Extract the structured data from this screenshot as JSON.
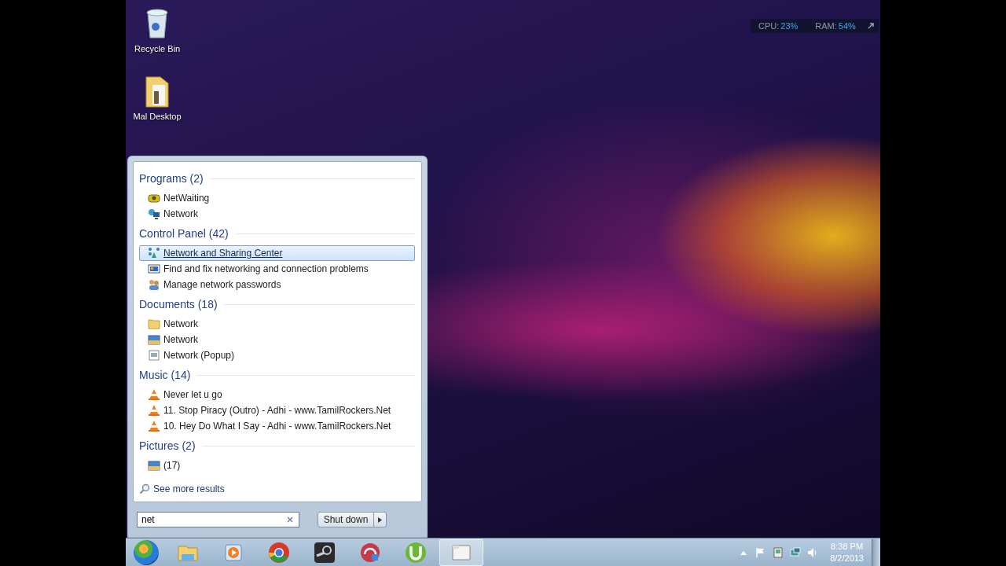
{
  "desktop_icons": [
    {
      "label": "Recycle Bin",
      "kind": "recycle"
    },
    {
      "label": "Mal Desktop",
      "kind": "folder"
    }
  ],
  "gadget": {
    "cpu_label": "CPU:",
    "cpu_value": "23%",
    "ram_label": "RAM:",
    "ram_value": "54%"
  },
  "start_menu": {
    "groups": [
      {
        "title": "Programs (2)",
        "items": [
          {
            "label": "NetWaiting",
            "kind": "phone",
            "selected": false
          },
          {
            "label": "Network",
            "kind": "network",
            "selected": false
          }
        ]
      },
      {
        "title": "Control Panel (42)",
        "items": [
          {
            "label": "Network and Sharing Center",
            "kind": "sharing",
            "selected": true
          },
          {
            "label": "Find and fix networking and connection problems",
            "kind": "troubleshoot",
            "selected": false
          },
          {
            "label": "Manage network passwords",
            "kind": "users",
            "selected": false
          }
        ]
      },
      {
        "title": "Documents (18)",
        "items": [
          {
            "label": "Network",
            "kind": "folder",
            "selected": false
          },
          {
            "label": "Network",
            "kind": "picture",
            "selected": false
          },
          {
            "label": "Network (Popup)",
            "kind": "document",
            "selected": false
          }
        ]
      },
      {
        "title": "Music (14)",
        "items": [
          {
            "label": "Never let u go",
            "kind": "cone",
            "selected": false
          },
          {
            "label": "11. Stop Piracy (Outro) - Adhi - www.TamilRockers.Net",
            "kind": "cone",
            "selected": false
          },
          {
            "label": "10. Hey Do What I Say - Adhi - www.TamilRockers.Net",
            "kind": "cone",
            "selected": false
          }
        ]
      },
      {
        "title": "Pictures (2)",
        "items": [
          {
            "label": "(17)",
            "kind": "picture",
            "selected": false
          }
        ]
      }
    ],
    "see_more": "See more results",
    "search": {
      "value": "net"
    },
    "shutdown": "Shut down"
  },
  "taskbar": {
    "apps": [
      {
        "kind": "explorer",
        "active": false
      },
      {
        "kind": "media",
        "active": false
      },
      {
        "kind": "chrome",
        "active": false
      },
      {
        "kind": "steam",
        "active": false
      },
      {
        "kind": "headphones",
        "active": false
      },
      {
        "kind": "torrent",
        "active": false
      },
      {
        "kind": "window",
        "active": true
      }
    ],
    "time": "8:38 PM",
    "date": "8/2/2013"
  }
}
